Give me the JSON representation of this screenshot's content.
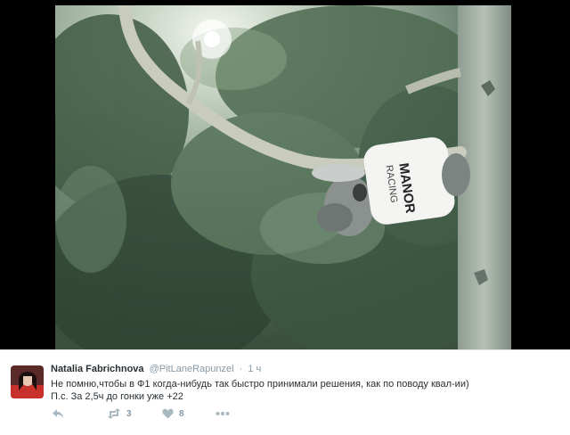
{
  "tweet": {
    "author_name": "Natalia Fabrichnova",
    "author_handle": "@PitLaneRapunzel",
    "separator": "·",
    "time": "1 ч",
    "text_line1": "Не помню,чтобы в Ф1 когда-нибудь так быстро принимали решения, как по поводу квал-ии)",
    "text_line2": "П.с. За 2,5ч до гонки уже +22",
    "retweet_count": "3",
    "like_count": "8"
  },
  "photo": {
    "shirt_text_line1": "MANOR",
    "shirt_text_line2": "RACING"
  },
  "icons": {
    "reply": "reply-icon",
    "retweet": "retweet-icon",
    "like": "heart-icon",
    "more": "more-icon"
  },
  "colors": {
    "action_gray": "#aab8c2",
    "name": "#292f33",
    "meta": "#8899a6"
  }
}
